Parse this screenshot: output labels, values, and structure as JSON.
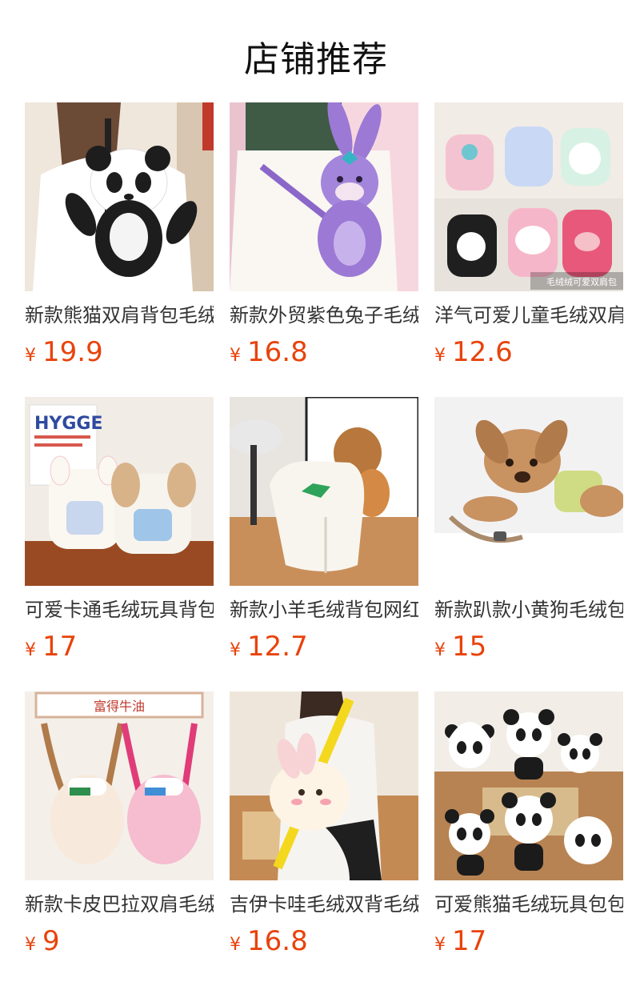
{
  "header": {
    "title": "店铺推荐"
  },
  "products": [
    {
      "name": "新款熊猫双肩背包毛绒",
      "currency": "¥",
      "price": "19.9",
      "image": "panda-backpack-photo"
    },
    {
      "name": "新款外贸紫色兔子毛绒",
      "currency": "¥",
      "price": "16.8",
      "image": "purple-bunny-photo"
    },
    {
      "name": "洋气可爱儿童毛绒双肩",
      "currency": "¥",
      "price": "12.6",
      "image": "kids-plush-backpacks-photo",
      "image_caption": "毛绒绒可爱双肩包"
    },
    {
      "name": "可爱卡通毛绒玩具背包",
      "currency": "¥",
      "price": "17",
      "image": "cartoon-plush-backpacks-photo",
      "image_caption": "HYGGE"
    },
    {
      "name": "新款小羊毛绒背包网红",
      "currency": "¥",
      "price": "12.7",
      "image": "lamb-plush-backpack-photo"
    },
    {
      "name": "新款趴款小黄狗毛绒包",
      "currency": "¥",
      "price": "15",
      "image": "yellow-dog-plush-photo"
    },
    {
      "name": "新款卡皮巴拉双肩毛绒",
      "currency": "¥",
      "price": "9",
      "image": "capybara-backpacks-photo",
      "image_caption": "富得牛油"
    },
    {
      "name": "吉伊卡哇毛绒双背毛绒",
      "currency": "¥",
      "price": "16.8",
      "image": "chiikawa-backpack-photo"
    },
    {
      "name": "可爱熊猫毛绒玩具包包",
      "currency": "¥",
      "price": "17",
      "image": "panda-plush-group-photo"
    }
  ]
}
